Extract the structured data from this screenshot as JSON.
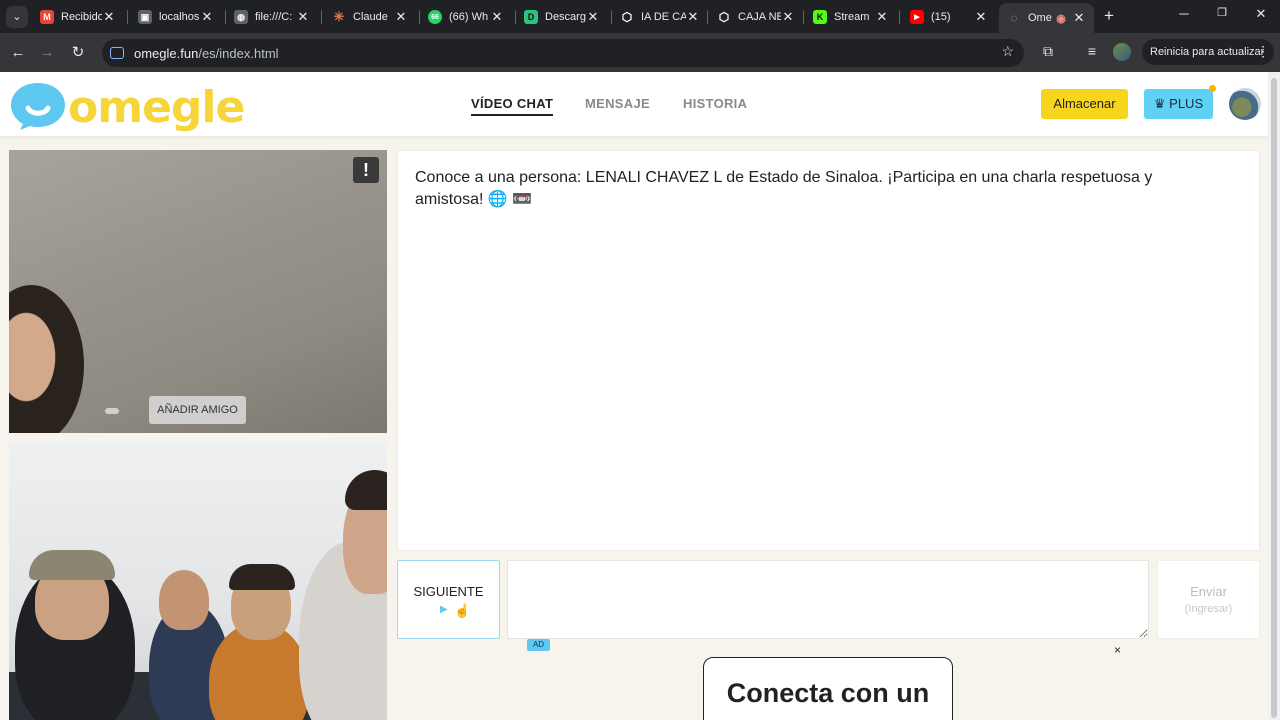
{
  "browser": {
    "tabs": [
      {
        "label": "Recibido",
        "color": "#ea4335",
        "glyph": "M"
      },
      {
        "label": "localhos",
        "color": "#5f6368",
        "glyph": "▣"
      },
      {
        "label": "file:///C:",
        "color": "#5f6368",
        "glyph": "◍"
      },
      {
        "label": "Claude",
        "color": "#d97757",
        "glyph": "✳"
      },
      {
        "label": "(66) Wh",
        "color": "#25d366",
        "glyph": "66"
      },
      {
        "label": "Descarg",
        "color": "#2ec27e",
        "glyph": "D"
      },
      {
        "label": "IA DE CA",
        "color": "#202124",
        "glyph": "⬡"
      },
      {
        "label": "CAJA NE",
        "color": "#202124",
        "glyph": "⬡"
      },
      {
        "label": "Stream",
        "color": "#53fc18",
        "glyph": "K"
      },
      {
        "label": "(15)",
        "color": "#ff0000",
        "glyph": "▶"
      },
      {
        "label": "Ome",
        "color": "#9aa0a6",
        "glyph": "◌"
      }
    ],
    "url_host": "omegle.fun",
    "url_path": "/es/index.html",
    "update_label": "Reinicia para actualizar"
  },
  "site": {
    "logo_text": "omegle",
    "nav": [
      "VÍDEO CHAT",
      "MENSAJE",
      "HISTORIA"
    ],
    "store_label": "Almacenar",
    "plus_label": "PLUS",
    "colors": {
      "brand_yellow": "#f6d53a",
      "accent_blue": "#5fc8f0"
    }
  },
  "video": {
    "report_label": "!",
    "add_friend_label": "AÑADIR AMIGO"
  },
  "chat": {
    "message": "Conoce a una persona: LENALI CHAVEZ L de Estado de Sinaloa. ¡Participa en una charla respetuosa y amistosa! 🌐 📼",
    "next_label": "SIGUIENTE",
    "input_value": "",
    "send_label": "Enviar",
    "send_hint": "(Ingresar)"
  },
  "ad": {
    "badge": "AD",
    "close": "×",
    "headline": "Conecta con un"
  }
}
